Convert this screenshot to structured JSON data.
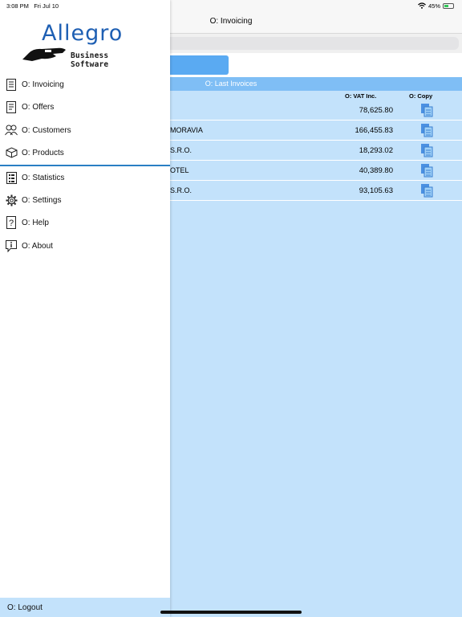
{
  "status_bar": {
    "time": "3:08 PM",
    "date": "Fri Jul 10",
    "battery": "45%",
    "wifi_icon": "wifi-icon"
  },
  "main": {
    "title": "O: Invoicing",
    "last_invoices_header": "O: Last Invoices",
    "columns": {
      "vat_inc": "O: VAT Inc.",
      "copy": "O: Copy"
    },
    "rows": [
      {
        "name": "",
        "amount": "78,625.80"
      },
      {
        "name": "MORAVIA",
        "amount": "166,455.83"
      },
      {
        "name": "S.R.O.",
        "amount": "18,293.02"
      },
      {
        "name": "OTEL",
        "amount": "40,389.80"
      },
      {
        "name": "S.R.O.",
        "amount": "93,105.63"
      }
    ]
  },
  "side_menu": {
    "logo": {
      "word": "Allegro",
      "subtitle": "Business Software"
    },
    "items": [
      {
        "label": "O: Invoicing",
        "icon": "invoice-icon"
      },
      {
        "label": "O: Offers",
        "icon": "offer-icon"
      },
      {
        "label": "O: Customers",
        "icon": "customers-icon"
      },
      {
        "label": "O: Products",
        "icon": "box-icon"
      },
      {
        "label": "O: Statistics",
        "icon": "statistics-icon"
      },
      {
        "label": "O: Settings",
        "icon": "gear-icon"
      },
      {
        "label": "O: Help",
        "icon": "help-icon"
      },
      {
        "label": "O: About",
        "icon": "info-icon"
      }
    ],
    "logout": "O: Logout"
  },
  "colors": {
    "accent": "#2a7fc4",
    "list_bg": "#c3e2fb",
    "header_bg": "#7fbef5",
    "button": "#5aaaf2",
    "logo": "#1e5fb3"
  }
}
